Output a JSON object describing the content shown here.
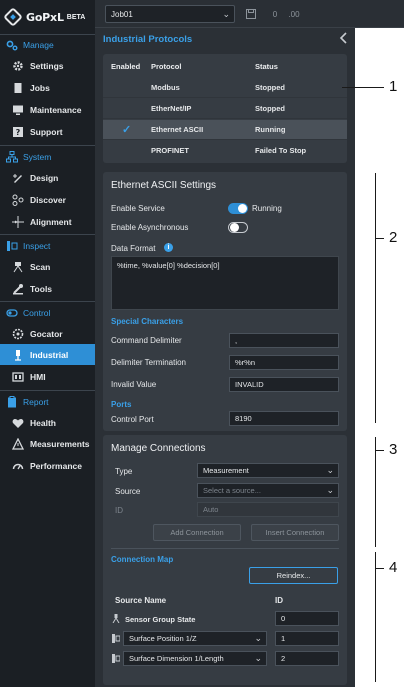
{
  "app": {
    "name": "GoPxL",
    "badge": "BETA"
  },
  "sidebar": {
    "sections": [
      {
        "label": "Manage",
        "icon": "gears-icon",
        "items": [
          {
            "label": "Settings",
            "icon": "gear-icon"
          },
          {
            "label": "Jobs",
            "icon": "document-icon"
          },
          {
            "label": "Maintenance",
            "icon": "monitor-icon"
          },
          {
            "label": "Support",
            "icon": "help-icon"
          }
        ]
      },
      {
        "label": "System",
        "icon": "network-icon",
        "items": [
          {
            "label": "Design",
            "icon": "design-icon"
          },
          {
            "label": "Discover",
            "icon": "discover-icon"
          },
          {
            "label": "Alignment",
            "icon": "alignment-icon"
          }
        ]
      },
      {
        "label": "Inspect",
        "icon": "inspect-icon",
        "items": [
          {
            "label": "Scan",
            "icon": "scan-icon"
          },
          {
            "label": "Tools",
            "icon": "tools-icon"
          }
        ]
      },
      {
        "label": "Control",
        "icon": "control-icon",
        "items": [
          {
            "label": "Gocator",
            "icon": "gocator-icon"
          },
          {
            "label": "Industrial",
            "icon": "industrial-icon",
            "active": true
          },
          {
            "label": "HMI",
            "icon": "hmi-icon"
          }
        ]
      },
      {
        "label": "Report",
        "icon": "clipboard-icon",
        "items": [
          {
            "label": "Health",
            "icon": "heart-icon"
          },
          {
            "label": "Measurements",
            "icon": "measurements-icon"
          },
          {
            "label": "Performance",
            "icon": "gauge-icon"
          }
        ]
      }
    ]
  },
  "topbar": {
    "job": "Job01",
    "icon_a": "0",
    "icon_b": ".00"
  },
  "panel": {
    "title": "Industrial Protocols",
    "protocols": {
      "headers": {
        "enabled": "Enabled",
        "protocol": "Protocol",
        "status": "Status"
      },
      "rows": [
        {
          "protocol": "Modbus",
          "status": "Stopped",
          "enabled": false
        },
        {
          "protocol": "EtherNet/IP",
          "status": "Stopped",
          "enabled": false
        },
        {
          "protocol": "Ethernet ASCII",
          "status": "Running",
          "enabled": true
        },
        {
          "protocol": "PROFINET",
          "status": "Failed To Stop",
          "enabled": false
        }
      ]
    },
    "ascii_settings": {
      "title": "Ethernet ASCII Settings",
      "enable_service_label": "Enable Service",
      "enable_service_state": "Running",
      "enable_service_on": true,
      "enable_async_label": "Enable Asynchronous",
      "enable_async_on": false,
      "data_format_label": "Data Format",
      "data_format_value": "%time, %value[0] %decision[0]",
      "special_chars_heading": "Special Characters",
      "command_delimiter_label": "Command Delimiter",
      "command_delimiter_value": ",",
      "delimiter_termination_label": "Delimiter Termination",
      "delimiter_termination_value": "%r%n",
      "invalid_value_label": "Invalid Value",
      "invalid_value_value": "INVALID",
      "ports_heading": "Ports",
      "control_port_label": "Control Port",
      "control_port_value": "8190"
    },
    "connections": {
      "title": "Manage Connections",
      "type_label": "Type",
      "type_value": "Measurement",
      "source_label": "Source",
      "source_placeholder": "Select a source...",
      "id_label": "ID",
      "id_placeholder": "Auto",
      "add_button": "Add Connection",
      "insert_button": "Insert Connection",
      "map_heading": "Connection Map",
      "reindex_button": "Reindex...",
      "col_source": "Source Name",
      "col_id": "ID",
      "map_rows": [
        {
          "source": "Sensor Group State",
          "id": "0",
          "dropdown": false
        },
        {
          "source": "Surface Position 1/Z",
          "id": "1",
          "dropdown": true
        },
        {
          "source": "Surface Dimension 1/Length",
          "id": "2",
          "dropdown": true
        }
      ]
    }
  },
  "callouts": [
    "1",
    "2",
    "3",
    "4"
  ],
  "colors": {
    "accent": "#2e8fd6",
    "link": "#3aa0e8",
    "sidebar_bg": "#1b1f24",
    "panel_bg": "#2b3036",
    "card_bg": "#363c43"
  }
}
